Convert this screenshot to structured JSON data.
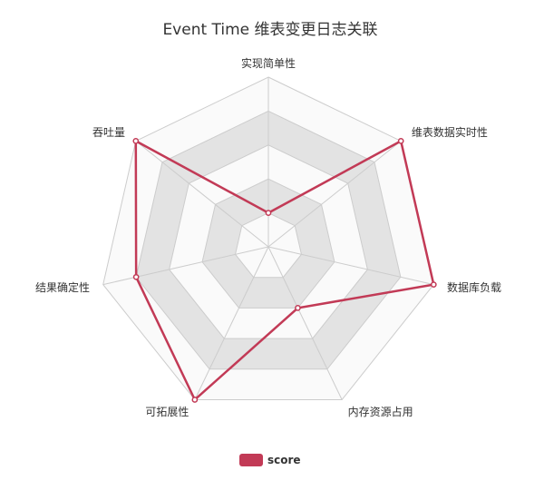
{
  "chart_data": {
    "type": "radar",
    "title": "Event Time 维表变更日志关联",
    "indicators": [
      "实现简单性",
      "维表数据实时性",
      "数据库负载",
      "内存资源占用",
      "可拓展性",
      "结果确定性",
      "吞吐量"
    ],
    "max": 5,
    "split_number": 5,
    "series": [
      {
        "name": "score",
        "values": [
          1,
          5,
          5,
          2,
          5,
          4,
          5
        ]
      }
    ],
    "legend": {
      "entries": [
        "score"
      ],
      "position": "bottom"
    },
    "colors": {
      "series": "#c23a56",
      "split_band_shaded": "#e3e3e3",
      "split_band_light": "#fafafa",
      "grid_line": "#cccccc",
      "text": "#333333",
      "title": "#333333"
    }
  }
}
